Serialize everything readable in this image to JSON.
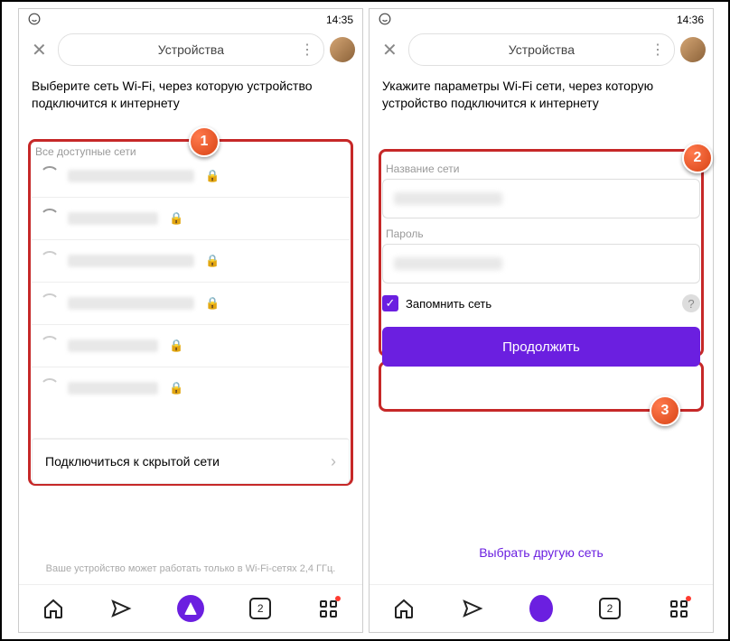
{
  "left": {
    "status_time": "14:35",
    "header_title": "Устройства",
    "instruction": "Выберите сеть Wi-Fi, через которую устройство подключится к интернету",
    "subheader": "Все доступные сети",
    "hidden_network": "Подключиться к скрытой сети",
    "footnote": "Ваше устройство может работать только в Wi-Fi-сетях 2,4 ГГц.",
    "tab_count": "2"
  },
  "right": {
    "status_time": "14:36",
    "header_title": "Устройства",
    "instruction": "Укажите параметры Wi-Fi сети, через которую устройство подключится к интернету",
    "name_label": "Название сети",
    "password_label": "Пароль",
    "remember_label": "Запомнить сеть",
    "continue_label": "Продолжить",
    "other_network": "Выбрать другую сеть",
    "tab_count": "2"
  },
  "badges": {
    "b1": "1",
    "b2": "2",
    "b3": "3"
  }
}
